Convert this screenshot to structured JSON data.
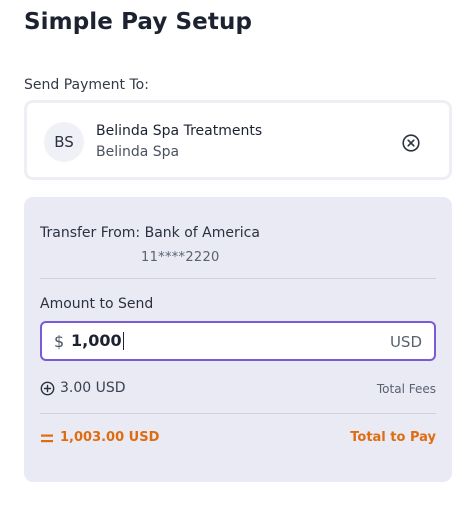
{
  "header": {
    "title": "Simple Pay Setup"
  },
  "recipient": {
    "section_label": "Send Payment To:",
    "initials": "BS",
    "name": "Belinda Spa Treatments",
    "subtitle": "Belinda Spa",
    "clear_icon": "circle-x-icon"
  },
  "transfer": {
    "from_text": "Transfer From: Bank of America",
    "account_masked": "11****2220"
  },
  "amount": {
    "label": "Amount to Send",
    "currency_symbol": "$",
    "value": "1,000",
    "currency_code": "USD"
  },
  "fees": {
    "icon": "plus-circle-icon",
    "value": "3.00 USD",
    "label": "Total Fees"
  },
  "total": {
    "icon": "equals-icon",
    "value": "1,003.00 USD",
    "label": "Total to Pay"
  },
  "colors": {
    "accent_orange": "#e06c10",
    "input_border": "#7a5ad6",
    "panel_bg": "#e9eaf4"
  }
}
